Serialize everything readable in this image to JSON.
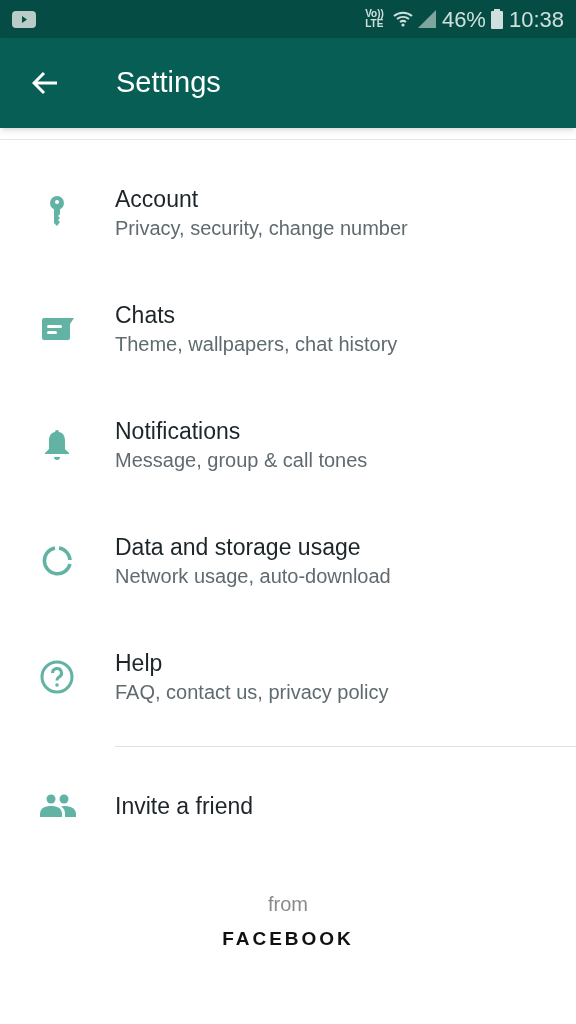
{
  "status_bar": {
    "volte": "Vo))",
    "network": "LTE",
    "battery": "46%",
    "time": "10:38"
  },
  "app_bar": {
    "title": "Settings"
  },
  "items": [
    {
      "kind": "key",
      "title": "Account",
      "subtitle": "Privacy, security, change number"
    },
    {
      "kind": "chat",
      "title": "Chats",
      "subtitle": "Theme, wallpapers, chat history"
    },
    {
      "kind": "bell",
      "title": "Notifications",
      "subtitle": "Message, group & call tones"
    },
    {
      "kind": "data",
      "title": "Data and storage usage",
      "subtitle": "Network usage, auto-download"
    },
    {
      "kind": "help",
      "title": "Help",
      "subtitle": "FAQ, contact us, privacy policy"
    }
  ],
  "invite": {
    "kind": "people",
    "title": "Invite a friend"
  },
  "footer": {
    "from": "from",
    "brand": "FACEBOOK"
  }
}
